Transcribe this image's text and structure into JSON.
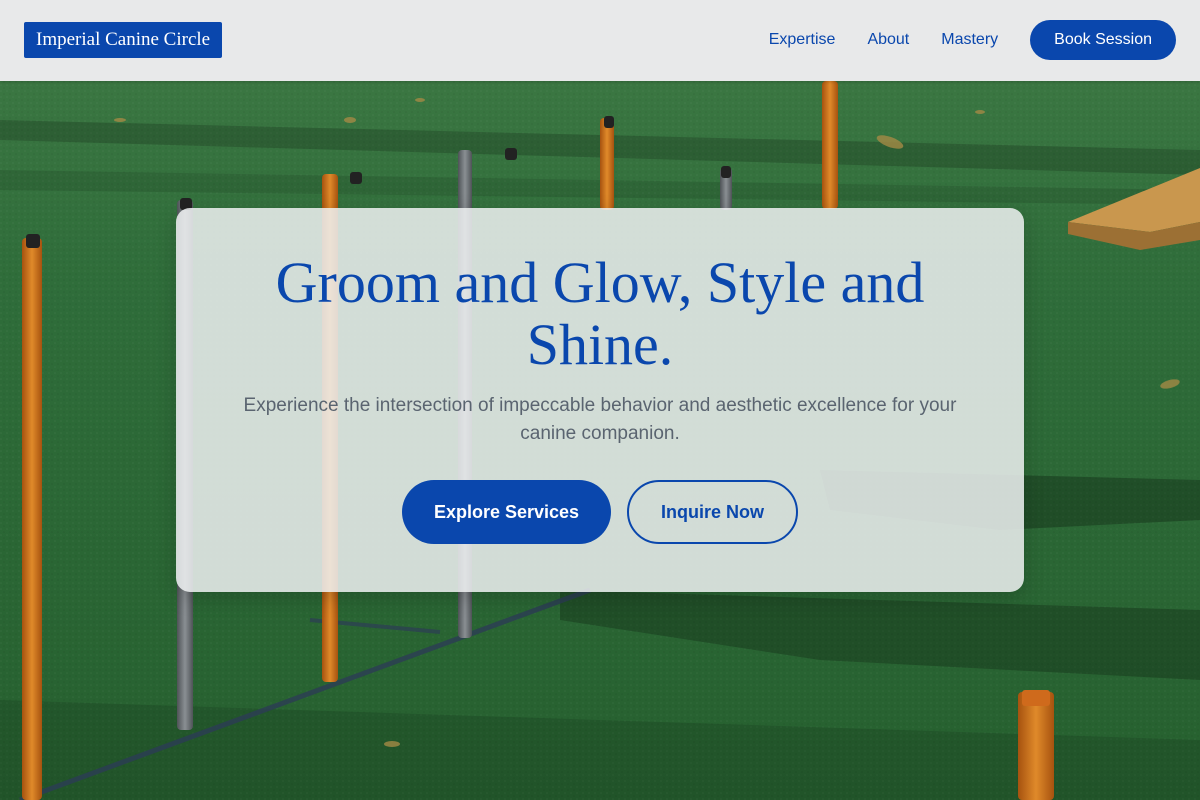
{
  "header": {
    "brand": "Imperial Canine Circle",
    "nav": [
      {
        "label": "Expertise"
      },
      {
        "label": "About"
      },
      {
        "label": "Mastery"
      }
    ],
    "cta_label": "Book Session"
  },
  "hero": {
    "title": "Groom and Glow, Style and Shine.",
    "subtitle": "Experience the intersection of impeccable behavior and aesthetic excellence for your canine companion.",
    "primary_button": "Explore Services",
    "secondary_button": "Inquire Now"
  },
  "theme": {
    "accent": "#0a47ad",
    "header_bg": "#e8e9ea",
    "grass": "#2f6a3a",
    "pole_orange": "#d3751d",
    "pole_grey": "#6b6f73"
  },
  "background": {
    "description_icon": "agility-course-photo"
  }
}
